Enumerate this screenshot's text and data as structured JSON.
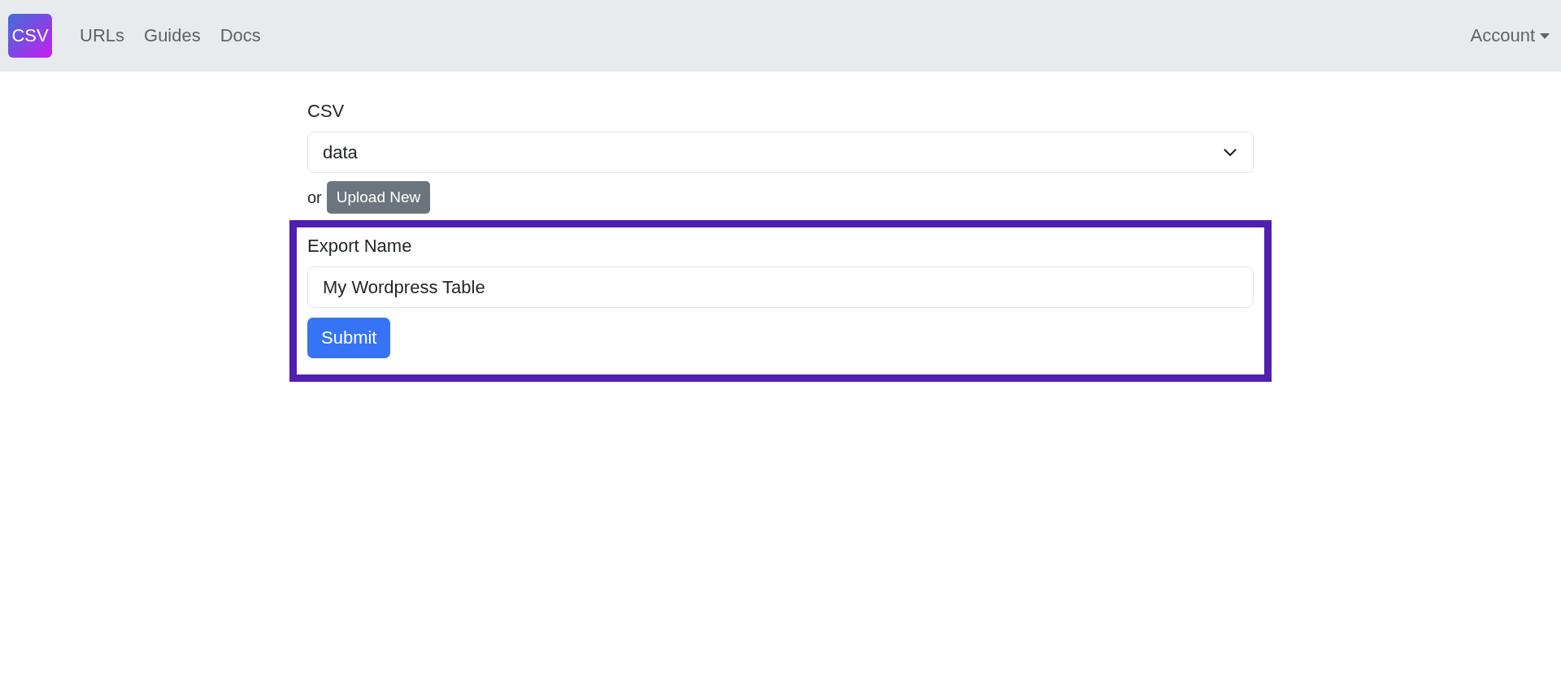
{
  "navbar": {
    "logo": "CSV",
    "links": [
      "URLs",
      "Guides",
      "Docs"
    ],
    "account": "Account"
  },
  "csv_field": {
    "label": "CSV",
    "value": "data"
  },
  "upload": {
    "prefix": "or",
    "button": "Upload New"
  },
  "export_form": {
    "label": "Export Name",
    "value": "My Wordpress Table",
    "submit": "Submit"
  }
}
